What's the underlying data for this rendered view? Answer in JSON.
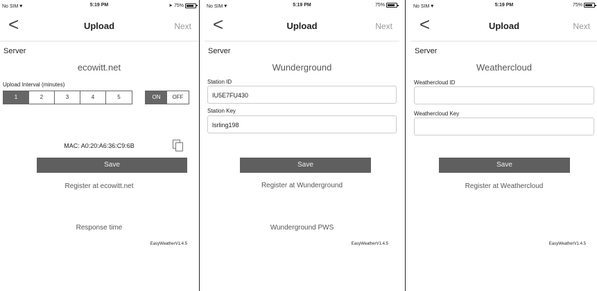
{
  "screens": [
    {
      "status": {
        "carrier": "No SIM",
        "time": "5:19 PM",
        "battery": "75%"
      },
      "nav": {
        "back": "<",
        "title": "Upload",
        "next": "Next"
      },
      "section": "Server",
      "server_name": "ecowitt.net",
      "interval": {
        "label": "Upload Interval (minutes)",
        "options": [
          "1",
          "2",
          "3",
          "4",
          "5"
        ],
        "selected": "1",
        "on_label": "ON",
        "off_label": "OFF",
        "toggle_state": "ON"
      },
      "mac": "MAC: A0:20:A6:36:C9:6B",
      "save": "Save",
      "register": "Register at ecowitt.net",
      "footer_link": "Response time",
      "version": "EasyWeatherV1.4.5"
    },
    {
      "status": {
        "carrier": "No SIM",
        "time": "5:19 PM",
        "battery": "75%"
      },
      "nav": {
        "back": "<",
        "title": "Upload",
        "next": "Next"
      },
      "section": "Server",
      "server_name": "Wunderground",
      "fields": [
        {
          "label": "Station ID",
          "value": "IU5E7FU430"
        },
        {
          "label": "Station Key",
          "value": "lsrling198"
        }
      ],
      "save": "Save",
      "register": "Register at Wunderground",
      "footer_link": "Wunderground PWS",
      "version": "EasyWeatherV1.4.5"
    },
    {
      "status": {
        "carrier": "No SIM",
        "time": "5:19 PM",
        "battery": "75%"
      },
      "nav": {
        "back": "<",
        "title": "Upload",
        "next": "Next"
      },
      "section": "Server",
      "server_name": "Weathercloud",
      "fields": [
        {
          "label": "Weathercloud ID",
          "value": ""
        },
        {
          "label": "Weathercloud Key",
          "value": ""
        }
      ],
      "save": "Save",
      "register": "Register at Weathercloud",
      "version": "EasyWeatherV1.4.5"
    }
  ]
}
